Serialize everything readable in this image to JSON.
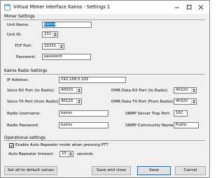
{
  "window": {
    "title": "Virtual Mimer Interface Kairos - Settings 1"
  },
  "mimer": {
    "heading": "Mimer Settings",
    "unit_name_label": "Unit Name:",
    "unit_name_value": "Kairos",
    "unit_id_label": "Unit ID:",
    "unit_id_value": "231",
    "tcp_port_label": "TCP Port:",
    "tcp_port_value": "20231",
    "password_label": "Password:",
    "password_value": "password"
  },
  "kairos": {
    "heading": "Kairos Radio Settings",
    "ip_label": "IP Address:",
    "ip_value": "192.168.0.201",
    "voice_rx_label": "Voice RX Port (to Radio):",
    "voice_rx_value": "40020",
    "voice_tx_label": "Voice TX Port (from Radio):",
    "voice_tx_value": "40120",
    "dmr_rx_label": "DMR Data RX Port (to Radio):",
    "dmr_rx_value": "40220",
    "dmr_tx_label": "DMR Data TX Port (From Radio):",
    "dmr_tx_value": "40320",
    "radio_user_label": "Radio Username:",
    "radio_user_value": "kairos",
    "radio_pass_label": "Radio Password:",
    "radio_pass_value": "kairos",
    "snmp_trap_label": "SNMP Server Trap Port:",
    "snmp_trap_value": "162",
    "snmp_comm_label": "SNMP Community Name:",
    "snmp_comm_value": "Public"
  },
  "operational": {
    "heading": "Operational settings",
    "auto_repeater_label": "Enable Auto Repeater mode when pressing PTT",
    "auto_repeater_checked": true,
    "timeout_label": "Auto Repeater timeout",
    "timeout_value": "10",
    "timeout_unit": "seconds"
  },
  "buttons": {
    "defaults": "Set all to default values",
    "save_close": "Save and close",
    "save": "Save",
    "cancel": "Cancel"
  },
  "colors": {
    "selection": "#0078d7",
    "accent_icon": "#5aa6d8"
  },
  "icons": {
    "app": "window-app-icon",
    "minimize": "minimize-icon",
    "maximize": "maximize-icon",
    "close": "close-icon"
  }
}
